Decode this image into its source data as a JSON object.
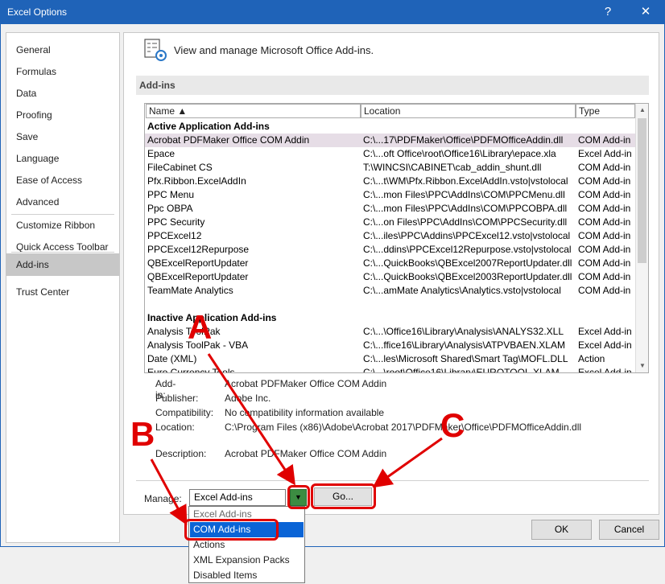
{
  "window": {
    "title": "Excel Options",
    "help_label": "?",
    "close_label": "✕"
  },
  "nav": {
    "items": [
      "General",
      "Formulas",
      "Data",
      "Proofing",
      "Save",
      "Language",
      "Ease of Access",
      "Advanced",
      "Customize Ribbon",
      "Quick Access Toolbar",
      "Add-ins",
      "Trust Center"
    ],
    "selected": "Add-ins"
  },
  "header": {
    "text": "View and manage Microsoft Office Add-ins."
  },
  "section": {
    "title": "Add-ins"
  },
  "table": {
    "columns": [
      "Name ▲",
      "Location",
      "Type"
    ],
    "active_header": "Active Application Add-ins",
    "active_rows": [
      [
        "Acrobat PDFMaker Office COM Addin",
        "C:\\...17\\PDFMaker\\Office\\PDFMOfficeAddin.dll",
        "COM Add-in"
      ],
      [
        "Epace",
        "C:\\...oft Office\\root\\Office16\\Library\\epace.xla",
        "Excel Add-in"
      ],
      [
        "FileCabinet CS",
        "T:\\WINCSI\\CABINET\\cab_addin_shunt.dll",
        "COM Add-in"
      ],
      [
        "Pfx.Ribbon.ExcelAddIn",
        "C:\\...t\\WM\\Pfx.Ribbon.ExcelAddIn.vsto|vstolocal",
        "COM Add-in"
      ],
      [
        "PPC Menu",
        "C:\\...mon Files\\PPC\\AddIns\\COM\\PPCMenu.dll",
        "COM Add-in"
      ],
      [
        "Ppc OBPA",
        "C:\\...mon Files\\PPC\\AddIns\\COM\\PPCOBPA.dll",
        "COM Add-in"
      ],
      [
        "PPC Security",
        "C:\\...on Files\\PPC\\AddIns\\COM\\PPCSecurity.dll",
        "COM Add-in"
      ],
      [
        "PPCExcel12",
        "C:\\...iles\\PPC\\Addins\\PPCExcel12.vsto|vstolocal",
        "COM Add-in"
      ],
      [
        "PPCExcel12Repurpose",
        "C:\\...ddins\\PPCExcel12Repurpose.vsto|vstolocal",
        "COM Add-in"
      ],
      [
        "QBExcelReportUpdater",
        "C:\\...QuickBooks\\QBExcel2007ReportUpdater.dll",
        "COM Add-in"
      ],
      [
        "QBExcelReportUpdater",
        "C:\\...QuickBooks\\QBExcel2003ReportUpdater.dll",
        "COM Add-in"
      ],
      [
        "TeamMate Analytics",
        "C:\\...amMate Analytics\\Analytics.vsto|vstolocal",
        "COM Add-in"
      ]
    ],
    "inactive_header": "Inactive Application Add-ins",
    "inactive_rows": [
      [
        "Analysis ToolPak",
        "C:\\...\\Office16\\Library\\Analysis\\ANALYS32.XLL",
        "Excel Add-in"
      ],
      [
        "Analysis ToolPak - VBA",
        "C:\\...ffice16\\Library\\Analysis\\ATPVBAEN.XLAM",
        "Excel Add-in"
      ],
      [
        "Date (XML)",
        "C:\\...les\\Microsoft Shared\\Smart Tag\\MOFL.DLL",
        "Action"
      ],
      [
        "Euro Currency Tools",
        "C:\\...\\root\\Office16\\Library\\EUROTOOL.XLAM",
        "Excel Add-in"
      ]
    ]
  },
  "details": {
    "addin_label": "Add-in:",
    "addin_value": "Acrobat PDFMaker Office COM Addin",
    "publisher_label": "Publisher:",
    "publisher_value": "Adobe Inc.",
    "compat_label": "Compatibility:",
    "compat_value": "No compatibility information available",
    "location_label": "Location:",
    "location_value": "C:\\Program Files (x86)\\Adobe\\Acrobat 2017\\PDFMaker\\Office\\PDFMOfficeAddin.dll",
    "description_label": "Description:",
    "description_value": "Acrobat PDFMaker Office COM Addin"
  },
  "manage": {
    "label": "Manage:",
    "selected": "Excel Add-ins",
    "go_label": "Go...",
    "options": [
      "Excel Add-ins",
      "COM Add-ins",
      "Actions",
      "XML Expansion Packs",
      "Disabled Items"
    ],
    "highlighted": "COM Add-ins"
  },
  "footer": {
    "ok_label": "OK",
    "cancel_label": "Cancel"
  },
  "annotations": {
    "a": "A",
    "b": "B",
    "c": "C"
  },
  "colors": {
    "titlebar": "#1f63b8",
    "annotation_red": "#e00000",
    "dropdown_highlight": "#0a64d6",
    "select_arrow_green": "#3c8c42"
  }
}
